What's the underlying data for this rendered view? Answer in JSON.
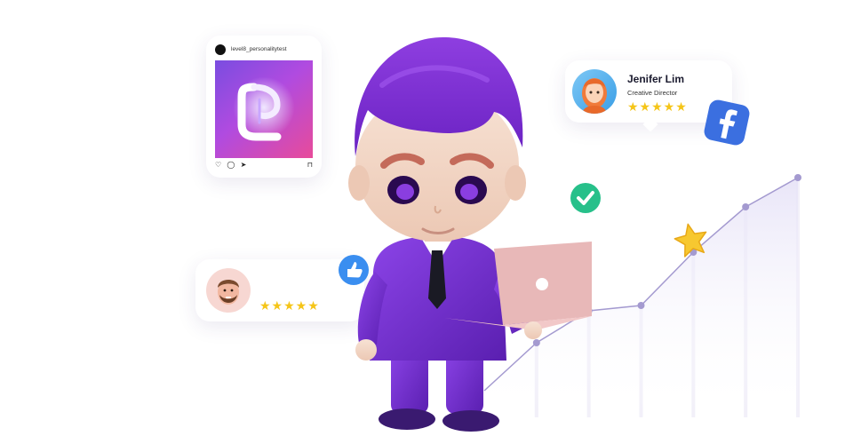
{
  "instagram_card": {
    "username": "level8_personalitytest",
    "actions": {
      "like": "♡",
      "comment": "◯",
      "share": "➤",
      "save": "⊓"
    }
  },
  "review_card_1": {
    "name": "Jenifer Lim",
    "role": "Creative Director",
    "stars": "★★★★★"
  },
  "review_card_2": {
    "stars": "★★★★★"
  },
  "colors": {
    "brand_purple": "#7b3fe4",
    "star_yellow": "#f5c518",
    "facebook_blue": "#3b6fe0",
    "check_green": "#27c08a",
    "chart_line": "#a49ad0"
  },
  "chart_data": {
    "type": "area",
    "x": [
      1,
      2,
      3,
      4,
      5,
      6,
      7
    ],
    "values": [
      10,
      28,
      40,
      42,
      62,
      79,
      90
    ],
    "title": "",
    "xlabel": "",
    "ylabel": "",
    "ylim": [
      0,
      100
    ]
  }
}
